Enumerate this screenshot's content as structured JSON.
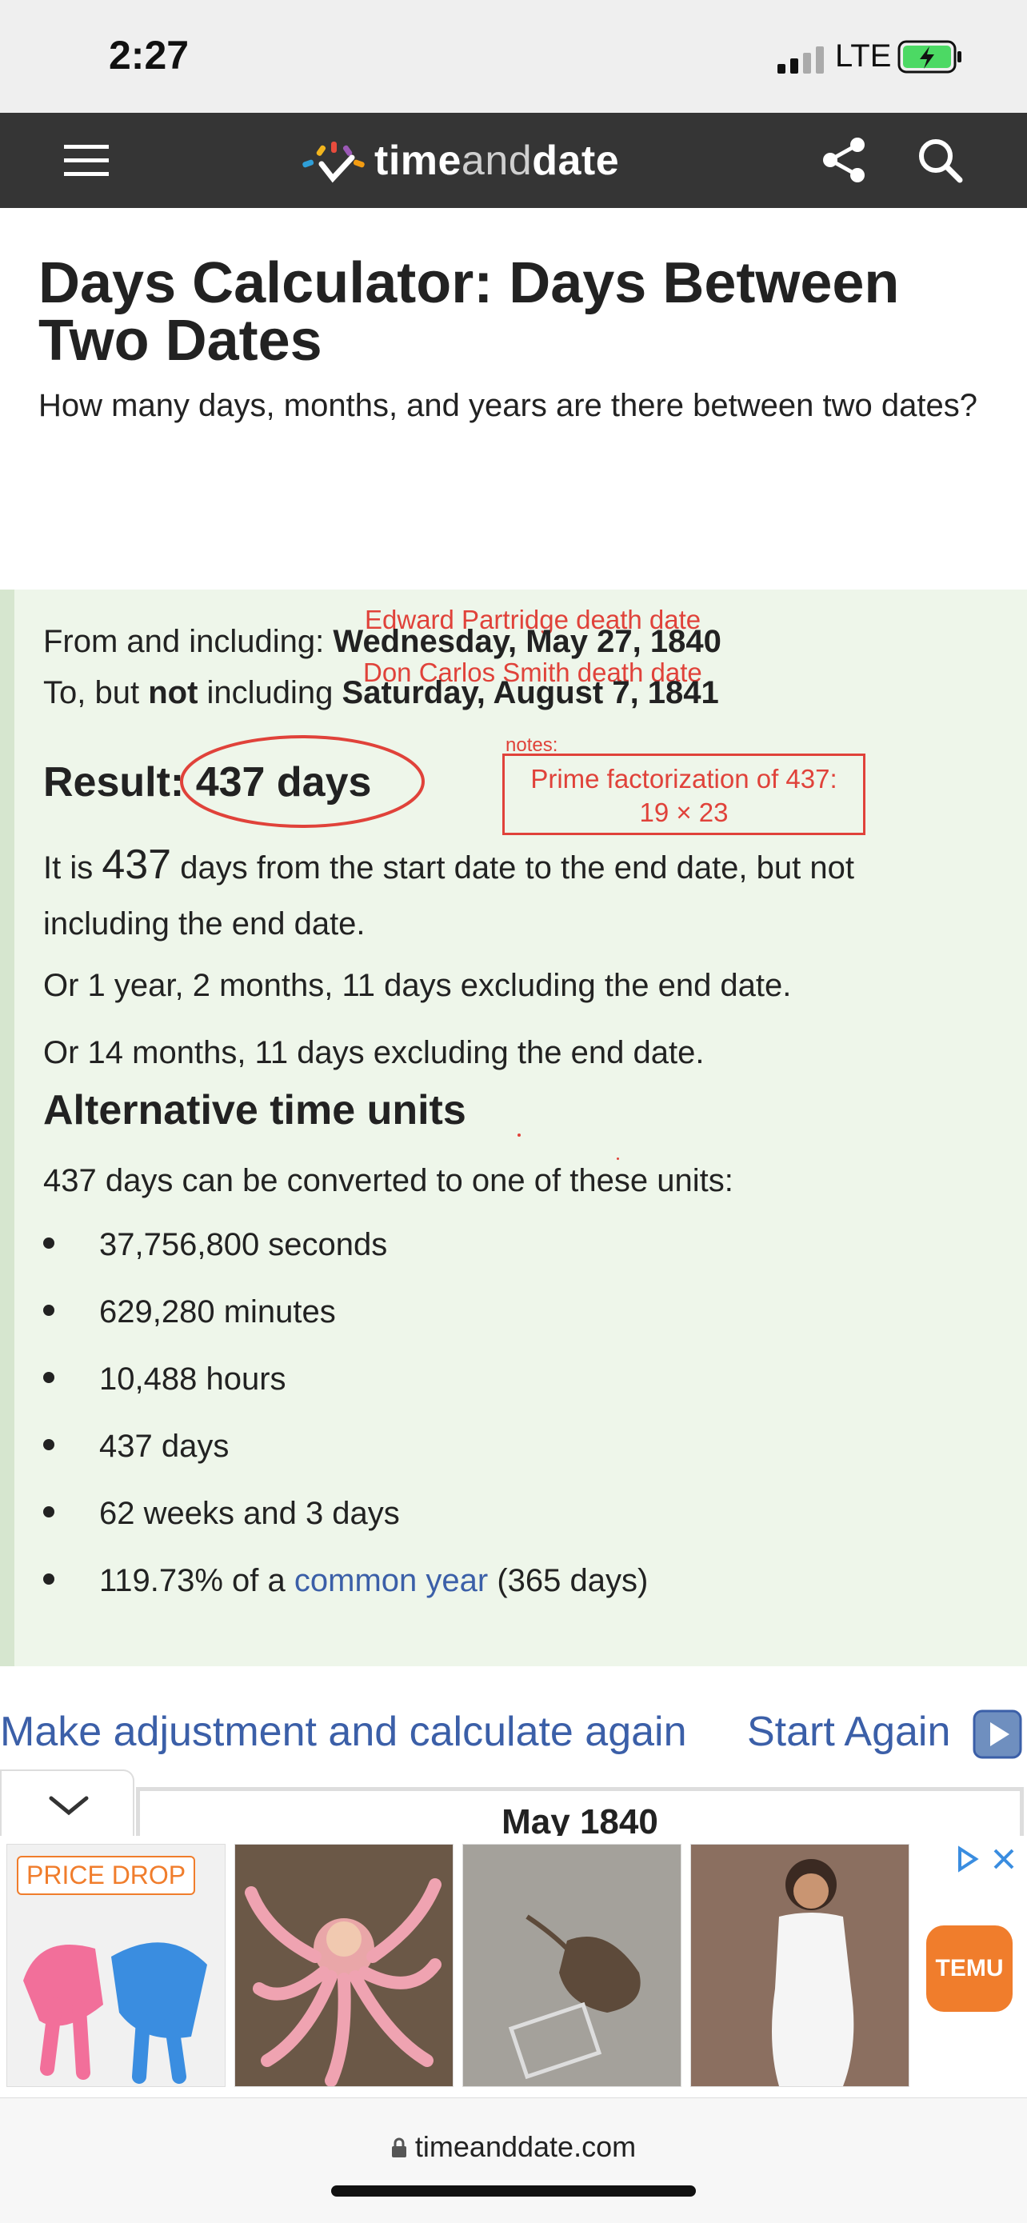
{
  "status": {
    "time": "2:27",
    "network": "LTE"
  },
  "header": {
    "brand_prefix": "time",
    "brand_and": "and",
    "brand_suffix": "date"
  },
  "page": {
    "title": "Days Calculator: Days Between Two Dates",
    "subtitle": "How many days, months, and years are there between two dates?"
  },
  "result": {
    "from_label": "From and including: ",
    "from_value": "Wednesday, May 27, 1840",
    "to_label": "To, but ",
    "to_not": "not",
    "to_label2": " including ",
    "to_value": "Saturday, August 7, 1841",
    "result_label": "Result: ",
    "result_value": "437 days",
    "desc_prefix": "It is ",
    "desc_number": "437",
    "desc_suffix": " days from the start date to the end date, but not including the end date.",
    "alt1": "Or 1 year, 2 months, 11 days excluding the end date.",
    "alt2": "Or 14 months, 11 days excluding the end date.",
    "units_heading": "Alternative time units",
    "units_intro": "437 days can be converted to one of these units:",
    "units": [
      "37,756,800 seconds",
      "629,280 minutes",
      "10,488 hours",
      "437 days",
      "62 weeks and 3 days"
    ],
    "last_unit_prefix": "119.73% of a ",
    "last_unit_link": "common year",
    "last_unit_suffix": " (365 days)"
  },
  "annotations": {
    "from_note": "Edward Partridge death date",
    "to_note": "Don Carlos Smith death date",
    "notes_label": "notes:",
    "prime_line1": "Prime factorization of 437:",
    "prime_line2": "19 × 23",
    "color": "#e0423a"
  },
  "actions": {
    "adjust": "Make adjustment and calculate again",
    "start_again": "Start Again"
  },
  "calendar": {
    "month_title": "May 1840"
  },
  "ad": {
    "badge": "PRICE DROP",
    "brand": "TEMU"
  },
  "browser": {
    "url": "timeanddate.com"
  },
  "colors": {
    "header_bg": "#353535",
    "panel_bg": "#eef6ea",
    "link": "#3b5fa8"
  }
}
